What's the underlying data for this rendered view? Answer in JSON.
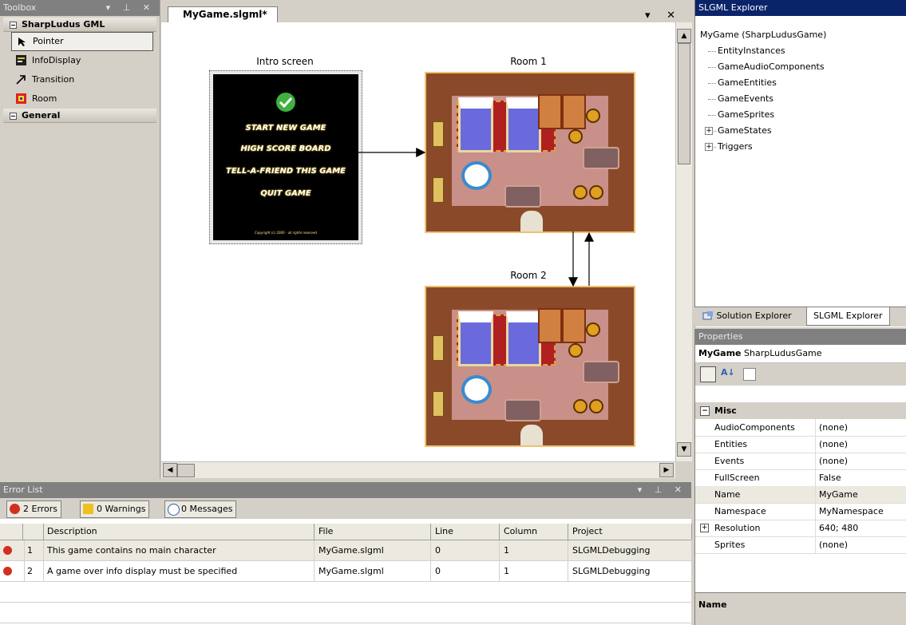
{
  "toolbox": {
    "title": "Toolbox",
    "groups": [
      {
        "label": "SharpLudus GML",
        "items": [
          {
            "label": "Pointer",
            "icon": "pointer-icon"
          },
          {
            "label": "InfoDisplay",
            "icon": "infodisplay-icon"
          },
          {
            "label": "Transition",
            "icon": "transition-arrow-icon"
          },
          {
            "label": "Room",
            "icon": "room-icon"
          }
        ]
      },
      {
        "label": "General",
        "items": []
      }
    ]
  },
  "editor": {
    "tab_label": "MyGame.slgml*",
    "nodes": {
      "intro_label": "Intro screen",
      "room1_label": "Room 1",
      "room2_label": "Room 2"
    },
    "intro_menu": [
      "START NEW GAME",
      "HIGH SCORE BOARD",
      "TELL-A-FRIEND THIS GAME",
      "QUIT GAME"
    ],
    "intro_footer": "Copyright (c) 2006 - all rights reserved"
  },
  "explorer": {
    "title": "SLGML Explorer",
    "root": "MyGame (SharpLudusGame)",
    "children": [
      {
        "label": "EntityInstances",
        "expandable": false
      },
      {
        "label": "GameAudioComponents",
        "expandable": false
      },
      {
        "label": "GameEntities",
        "expandable": false
      },
      {
        "label": "GameEvents",
        "expandable": false
      },
      {
        "label": "GameSprites",
        "expandable": false
      },
      {
        "label": "GameStates",
        "expandable": true
      },
      {
        "label": "Triggers",
        "expandable": true
      }
    ],
    "tabs": [
      "Solution Explorer",
      "SLGML Explorer"
    ]
  },
  "properties": {
    "title": "Properties",
    "object_name": "MyGame",
    "object_type": "SharpLudusGame",
    "category": "Misc",
    "rows": [
      {
        "key": "AudioComponents",
        "value": "(none)",
        "expandable": false
      },
      {
        "key": "Entities",
        "value": "(none)",
        "expandable": false
      },
      {
        "key": "Events",
        "value": "(none)",
        "expandable": false
      },
      {
        "key": "FullScreen",
        "value": "False",
        "expandable": false
      },
      {
        "key": "Name",
        "value": "MyGame",
        "expandable": false
      },
      {
        "key": "Namespace",
        "value": "MyNamespace",
        "expandable": false
      },
      {
        "key": "Resolution",
        "value": "640; 480",
        "expandable": true
      },
      {
        "key": "Sprites",
        "value": "(none)",
        "expandable": false
      }
    ],
    "description_title": "Name"
  },
  "error_list": {
    "title": "Error List",
    "buttons": {
      "errors": "2 Errors",
      "warnings": "0 Warnings",
      "messages": "0 Messages"
    },
    "columns": [
      "Description",
      "File",
      "Line",
      "Column",
      "Project"
    ],
    "rows": [
      {
        "num": "1",
        "description": "This game contains no main character",
        "file": "MyGame.slgml",
        "line": "0",
        "column": "1",
        "project": "SLGMLDebugging"
      },
      {
        "num": "2",
        "description": "A game over info display must be specified",
        "file": "MyGame.slgml",
        "line": "0",
        "column": "1",
        "project": "SLGMLDebugging"
      }
    ]
  },
  "colors": {
    "title_active": "#0a246a",
    "title_inactive": "#808080",
    "error_icon": "#d03020"
  }
}
